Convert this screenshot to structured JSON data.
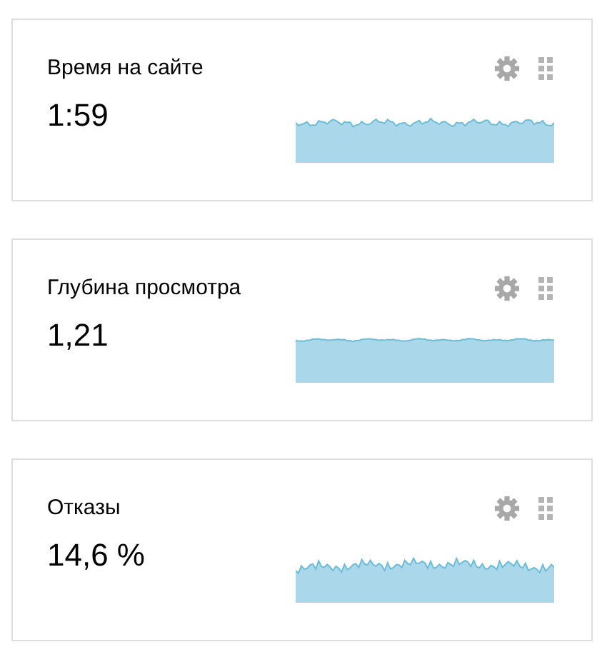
{
  "widgets": [
    {
      "title": "Время на сайте",
      "value": "1:59"
    },
    {
      "title": "Глубина просмотра",
      "value": "1,21"
    },
    {
      "title": "Отказы",
      "value": "14,6 %"
    }
  ]
}
